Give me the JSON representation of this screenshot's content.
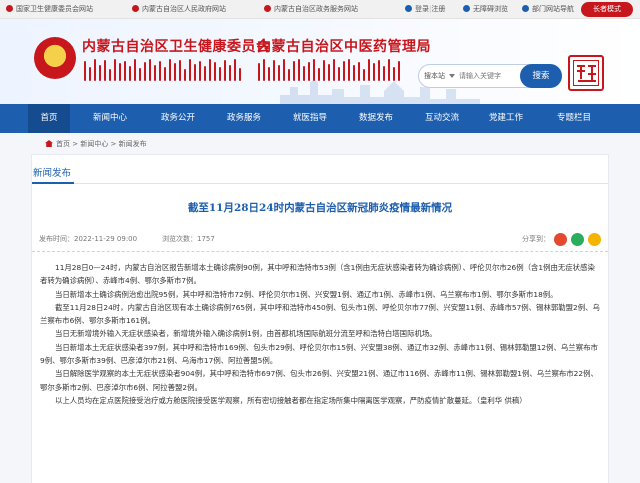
{
  "topbar": {
    "links": [
      "国家卫生健康委员会网站",
      "内蒙古自治区人民政府网站",
      "内蒙古自治区政务服务网站"
    ],
    "login": "登录",
    "register": "注册",
    "accessibility": "无障碍浏览",
    "dept_nav": "部门网站导航",
    "care_mode": "长者模式"
  },
  "header": {
    "title_health": "内蒙古自治区卫生健康委员会",
    "title_tcm": "内蒙古自治区中医药管理局",
    "search_label": "搜本站",
    "search_placeholder": "请输入关键字",
    "search_button": "搜索"
  },
  "nav": {
    "items": [
      "首页",
      "新闻中心",
      "政务公开",
      "政务服务",
      "就医指导",
      "数据发布",
      "互动交流",
      "党建工作",
      "专题栏目"
    ],
    "active_index": 0
  },
  "breadcrumb": {
    "home": "首页",
    "sep": " > ",
    "level1": "新闻中心",
    "level2": "新闻发布"
  },
  "section": {
    "title": "新闻发布"
  },
  "article": {
    "title": "截至11月28日24时内蒙古自治区新冠肺炎疫情最新情况",
    "publish_time": "发布时间：2022-11-29 09:00",
    "views": "浏览次数：1757",
    "share_label": "分享到：",
    "paragraphs": [
      "11月28日0—24时，内蒙古自治区报告新增本土确诊病例90例，其中呼和浩特市53例（含1例由无症状感染者转为确诊病例）、呼伦贝尔市26例（含1例由无症状感染者转为确诊病例）、赤峰市4例、鄂尔多斯市7例。",
      "当日新增本土确诊病例治愈出院95例，其中呼和浩特市72例、呼伦贝尔市1例、兴安盟1例、通辽市1例、赤峰市1例、乌兰察布市1例、鄂尔多斯市18例。",
      "截至11月28日24时，内蒙古自治区现有本土确诊病例765例，其中呼和浩特市450例、包头市1例、呼伦贝尔市77例、兴安盟11例、赤峰市57例、锡林郭勒盟2例、乌兰察布市6例、鄂尔多斯市161例。",
      "当日无新增境外输入无症状感染者，新增境外输入确诊病例1例，由首都机场国际航班分流至呼和浩特白塔国际机场。",
      "当日新增本土无症状感染者397例，其中呼和浩特市169例、包头市29例、呼伦贝尔市15例、兴安盟38例、通辽市32例、赤峰市11例、锡林郭勒盟12例、乌兰察布市9例、鄂尔多斯市39例、巴彦淖尔市21例、乌海市17例、阿拉善盟5例。",
      "当日解除医学观察的本土无症状感染者904例，其中呼和浩特市697例、包头市26例、兴安盟21例、通辽市116例、赤峰市11例、锡林郭勒盟1例、乌兰察布市22例、鄂尔多斯市2例、巴彦淖尔市6例、阿拉善盟2例。",
      "以上人员均在定点医院接受治疗或方舱医院接受医学观察，所有密切接触者都在指定场所集中隔离医学观察，严防疫情扩散蔓延。（皇利华 供稿）"
    ]
  },
  "colors": {
    "brand_red": "#c8161d",
    "nav_blue": "#1d5fae"
  }
}
